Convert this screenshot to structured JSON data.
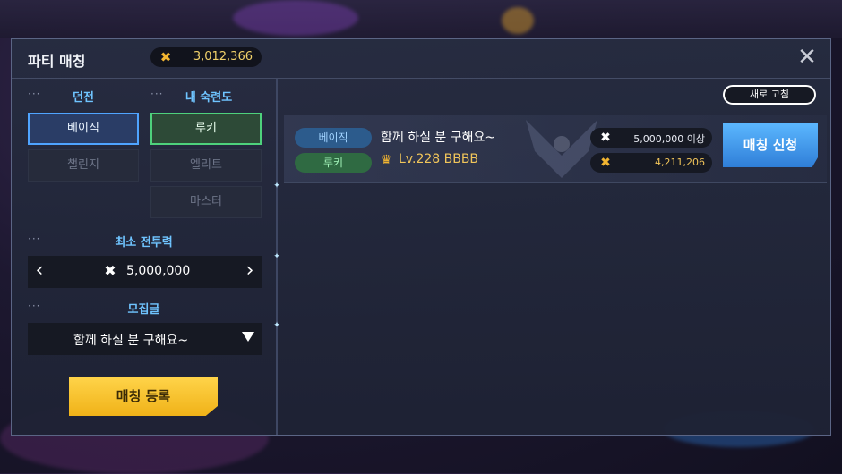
{
  "header": {
    "title": "파티 매칭",
    "currency_value": "3,012,366",
    "currency_icon": "crossed-swords-icon",
    "close_symbol": "✕"
  },
  "filters": {
    "dungeon": {
      "title": "던전",
      "options": [
        "베이직",
        "챌린지"
      ],
      "selected": "베이직"
    },
    "proficiency": {
      "title": "내 숙련도",
      "options": [
        "루키",
        "엘리트",
        "마스터"
      ],
      "selected": "루키"
    },
    "min_power": {
      "title": "최소 전투력",
      "value": "5,000,000",
      "prev_symbol": "‹",
      "next_symbol": "›"
    },
    "recruit": {
      "title": "모집글",
      "value": "함께 하실 분 구해요~"
    },
    "dots": "···",
    "register_label": "매칭 등록"
  },
  "list": {
    "refresh_label": "새로 고침",
    "parties": [
      {
        "dungeon_tag": "베이직",
        "proficiency_tag": "루키",
        "message": "함께 하실 분 구해요~",
        "leader": "Lv.228 BBBB",
        "required_power": "5,000,000 이상",
        "leader_power": "4,211,206",
        "apply_label": "매칭 신청"
      }
    ]
  },
  "colors": {
    "accent_blue": "#4fa4ff",
    "accent_green": "#4ed17c",
    "gold": "#f2b531",
    "register_yellow": "#f0b218",
    "apply_blue": "#2f7ed8"
  }
}
